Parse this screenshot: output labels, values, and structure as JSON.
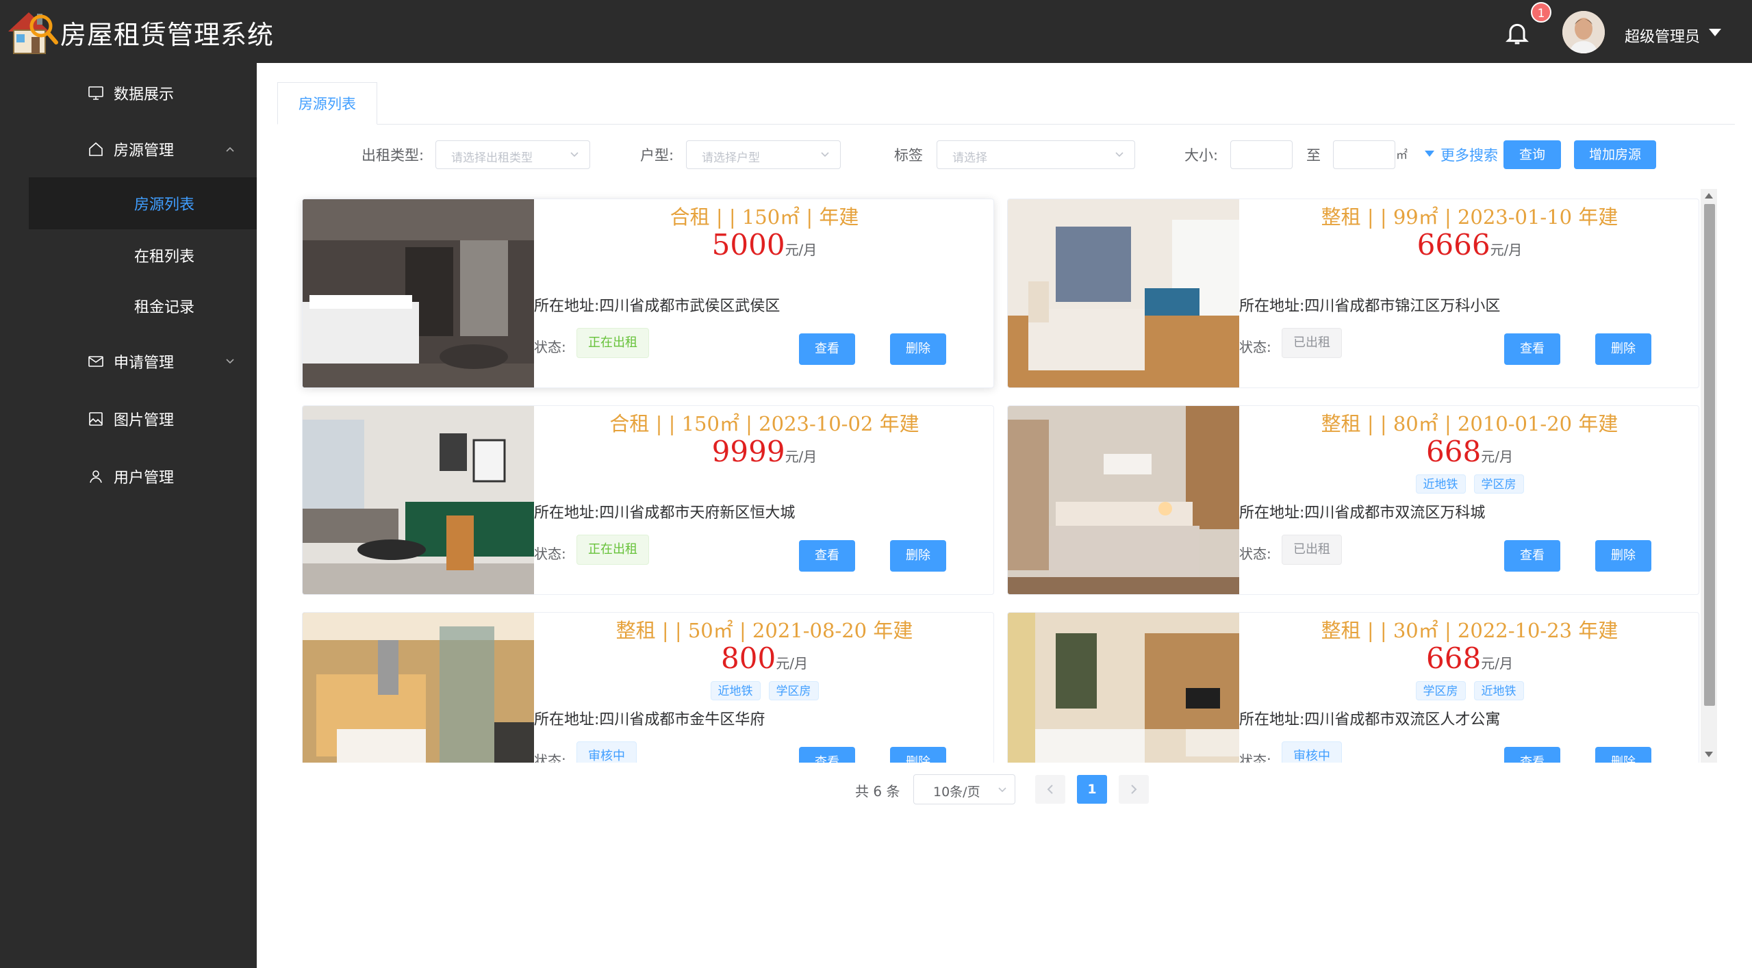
{
  "header": {
    "app_title": "房屋租赁管理系统",
    "notification_count": "1",
    "user_name": "超级管理员"
  },
  "sidebar": {
    "items": [
      {
        "label": "数据展示",
        "icon": "monitor-icon"
      },
      {
        "label": "房源管理",
        "icon": "home-icon",
        "expanded": true,
        "children": [
          {
            "label": "房源列表",
            "active": true
          },
          {
            "label": "在租列表"
          },
          {
            "label": "租金记录"
          }
        ]
      },
      {
        "label": "申请管理",
        "icon": "mail-icon",
        "expanded": false
      },
      {
        "label": "图片管理",
        "icon": "picture-icon"
      },
      {
        "label": "用户管理",
        "icon": "user-icon"
      }
    ]
  },
  "tabs": [
    {
      "label": "房源列表",
      "active": true
    }
  ],
  "filters": {
    "rent_type_label": "出租类型:",
    "rent_type_placeholder": "请选择出租类型",
    "layout_label": "户型:",
    "layout_placeholder": "请选择户型",
    "tag_label": "标签",
    "tag_placeholder": "请选择",
    "size_label": "大小:",
    "size_to": "至",
    "size_unit": "㎡",
    "more_search": "更多搜索",
    "query_button": "查询",
    "add_button": "增加房源"
  },
  "card_labels": {
    "address_prefix": "所在地址:",
    "status_prefix": "状态:",
    "view_button": "查看",
    "delete_button": "删除",
    "price_unit": "元/月"
  },
  "listings": [
    {
      "title": "合租 | | 150㎡ | 年建",
      "price": "5000",
      "tags": [],
      "address": "四川省成都市武侯区武侯区",
      "status": "正在出租",
      "status_color": "green",
      "photo": "modern-hotel-room"
    },
    {
      "title": "整租 | | 99㎡ | 2023-01-10 年建",
      "price": "6666",
      "tags": [],
      "address": "四川省成都市锦江区万科小区",
      "status": "已出租",
      "status_color": "gray",
      "photo": "bedroom-with-sofa"
    },
    {
      "title": "合租 | | 150㎡ | 2023-10-02 年建",
      "price": "9999",
      "tags": [],
      "address": "四川省成都市天府新区恒大城",
      "status": "正在出租",
      "status_color": "green",
      "photo": "living-room-green-sofa"
    },
    {
      "title": "整租 | | 80㎡ | 2010-01-20 年建",
      "price": "668",
      "tags": [
        "近地铁",
        "学区房"
      ],
      "address": "四川省成都市双流区万科城",
      "status": "已出租",
      "status_color": "gray",
      "photo": "warm-bedroom"
    },
    {
      "title": "整租 | | 50㎡ | 2021-08-20 年建",
      "price": "800",
      "tags": [
        "近地铁",
        "学区房"
      ],
      "address": "四川省成都市金牛区华府",
      "status": "审核中",
      "status_color": "blue",
      "photo": "kitchen-apartment"
    },
    {
      "title": "整租 | | 30㎡ | 2022-10-23 年建",
      "price": "668",
      "tags": [
        "学区房",
        "近地铁"
      ],
      "address": "四川省成都市双流区人才公寓",
      "status": "审核中",
      "status_color": "blue",
      "photo": "studio-bedroom"
    }
  ],
  "pagination": {
    "total_text": "共 6 条",
    "page_size": "10条/页",
    "current_page": "1"
  },
  "colors": {
    "primary": "#409eff",
    "sidebar_bg": "#2c2c2c",
    "title_orange": "#e6a23c",
    "price_red": "#e02020"
  }
}
